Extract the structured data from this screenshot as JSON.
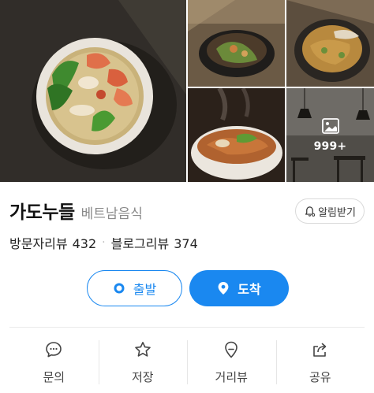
{
  "gallery": {
    "more_count": "999+"
  },
  "place": {
    "name": "가도누들",
    "category": "베트남음식",
    "notify_label": "알림받기"
  },
  "reviews": {
    "visitor_label": "방문자리뷰",
    "visitor_count": "432",
    "blog_label": "블로그리뷰",
    "blog_count": "374"
  },
  "route": {
    "depart_label": "출발",
    "arrive_label": "도착"
  },
  "actions": [
    {
      "label": "문의",
      "icon": "chat-icon"
    },
    {
      "label": "저장",
      "icon": "star-icon"
    },
    {
      "label": "거리뷰",
      "icon": "location-pin-icon"
    },
    {
      "label": "공유",
      "icon": "share-icon"
    }
  ],
  "colors": {
    "accent": "#1a88f0",
    "muted": "#8a8a8a"
  }
}
